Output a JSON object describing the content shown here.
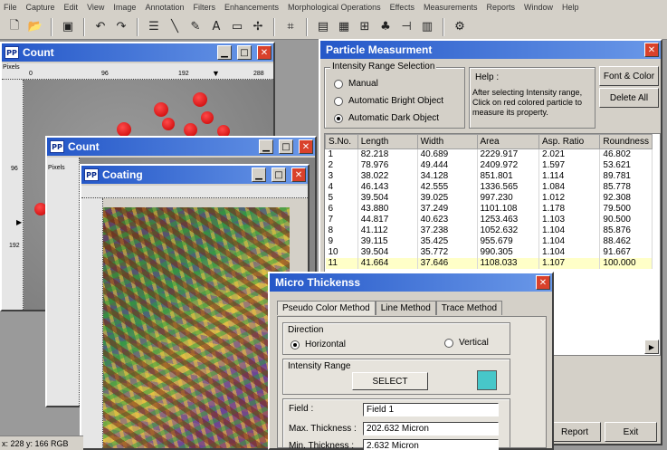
{
  "menu": [
    "File",
    "Capture",
    "Edit",
    "View",
    "Image",
    "Annotation",
    "Filters",
    "Enhancements",
    "Morphological Operations",
    "Effects",
    "Measurements",
    "Reports",
    "Window",
    "Help"
  ],
  "windows": {
    "count1": {
      "title": "Count",
      "ruler_unit": "Pixels",
      "h_ticks": [
        "0",
        "96",
        "192",
        "288"
      ],
      "v_ticks": [
        "96",
        "192"
      ]
    },
    "count2": {
      "title": "Count",
      "ruler_unit": "Pixels"
    },
    "coating": {
      "title": "Coating"
    }
  },
  "particle": {
    "title": "Particle Measurment",
    "intensity_group": "Intensity Range Selection",
    "options": [
      "Manual",
      "Automatic Bright Object",
      "Automatic Dark Object"
    ],
    "selected_option": 2,
    "help_title": "Help :",
    "help_text": "After selecting Intensity range, Click on red colored particle to measure its property.",
    "font_color_btn": "Font & Color",
    "delete_all_btn": "Delete All",
    "columns": [
      "S.No.",
      "Length",
      "Width",
      "Area",
      "Asp. Ratio",
      "Roundness"
    ],
    "rows": [
      [
        "1",
        "82.218",
        "40.689",
        "2229.917",
        "2.021",
        "46.802"
      ],
      [
        "2",
        "78.976",
        "49.444",
        "2409.972",
        "1.597",
        "53.621"
      ],
      [
        "3",
        "38.022",
        "34.128",
        "851.801",
        "1.114",
        "89.781"
      ],
      [
        "4",
        "46.143",
        "42.555",
        "1336.565",
        "1.084",
        "85.778"
      ],
      [
        "5",
        "39.504",
        "39.025",
        "997.230",
        "1.012",
        "92.308"
      ],
      [
        "6",
        "43.880",
        "37.249",
        "1101.108",
        "1.178",
        "79.500"
      ],
      [
        "7",
        "44.817",
        "40.623",
        "1253.463",
        "1.103",
        "90.500"
      ],
      [
        "8",
        "41.112",
        "37.238",
        "1052.632",
        "1.104",
        "85.876"
      ],
      [
        "9",
        "39.115",
        "35.425",
        "955.679",
        "1.104",
        "88.462"
      ],
      [
        "10",
        "39.504",
        "35.772",
        "990.305",
        "1.104",
        "91.667"
      ],
      [
        "11",
        "41.664",
        "37.646",
        "1108.033",
        "1.107",
        "100.000"
      ]
    ],
    "report_btn": "Report",
    "exit_btn": "Exit"
  },
  "micro": {
    "title": "Micro Thickenss",
    "tabs": [
      "Pseudo Color Method",
      "Line Method",
      "Trace Method"
    ],
    "active_tab": 0,
    "direction_label": "Direction",
    "horizontal_label": "Horizontal",
    "vertical_label": "Vertical",
    "intensity_label": "Intensity Range",
    "select_btn": "SELECT",
    "swatch_color": "#47c7c9",
    "field_label": "Field :",
    "field_value": "Field 1",
    "max_label": "Max. Thickness :",
    "max_value": "202.632 Micron",
    "min_label": "Min. Thickness :",
    "min_value": "2.632 Micron"
  },
  "status": "x: 228 y: 166 RGB"
}
